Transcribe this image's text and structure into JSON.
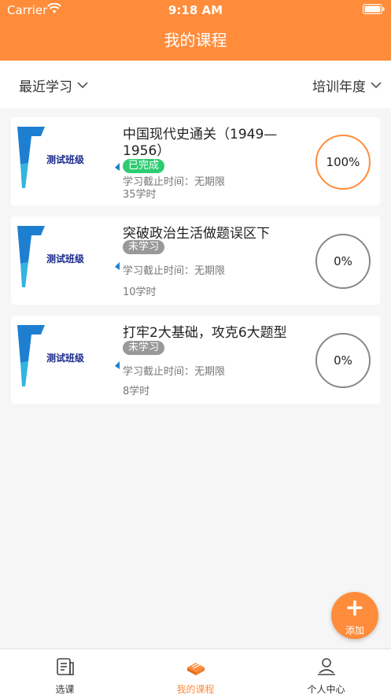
{
  "status_bar": {
    "carrier": "Carrier",
    "time": "9:18 AM"
  },
  "header": {
    "title": "我的课程"
  },
  "filters": {
    "left": "最近学习",
    "right": "培训年度"
  },
  "courses": [
    {
      "thumb_text": "测试班级",
      "title": "中国现代史通关（1949—1956）",
      "status": "已完成",
      "deadline": "学习截止时间：无期限",
      "hours": "35学时",
      "progress": "100%"
    },
    {
      "thumb_text": "测试班级",
      "title": "突破政治生活做题误区下",
      "status": "未学习",
      "deadline": "学习截止时间：无期限",
      "hours": "10学时",
      "progress": "0%"
    },
    {
      "thumb_text": "测试班级",
      "title": "打牢2大基础，攻克6大题型",
      "status": "未学习",
      "deadline": "学习截止时间：无期限",
      "hours": "8学时",
      "progress": "0%"
    }
  ],
  "fab": {
    "label": "添加",
    "icon": "plus-icon"
  },
  "tabbar": [
    {
      "label": "选课",
      "icon": "course-list-icon"
    },
    {
      "label": "我的课程",
      "icon": "book-icon"
    },
    {
      "label": "个人中心",
      "icon": "user-icon"
    }
  ],
  "colors": {
    "accent": "#ff8c3b",
    "done": "#2ecc71",
    "todo": "#999999"
  }
}
